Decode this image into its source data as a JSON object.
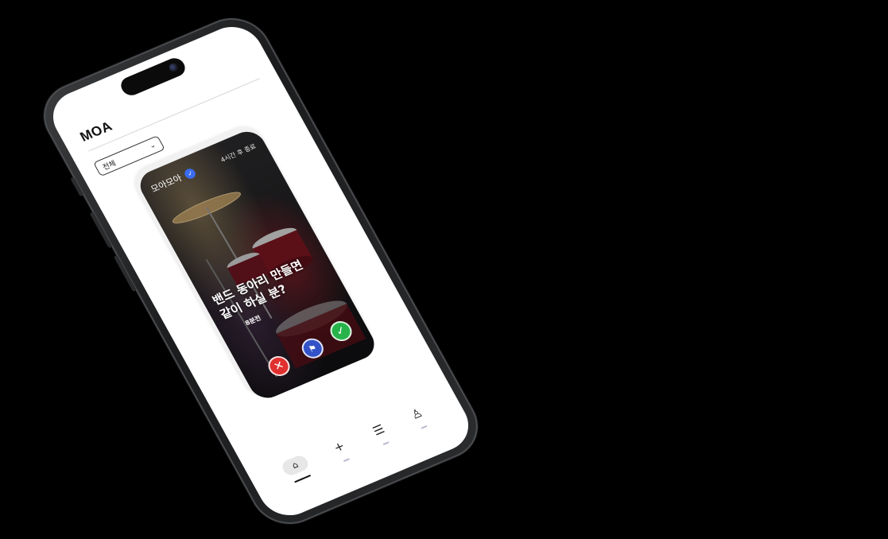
{
  "app": {
    "logo": "MOA"
  },
  "filter": {
    "selected": "전체"
  },
  "card": {
    "author": "모아모아",
    "deadline": "4시간 후 종료",
    "title_line1": "밴드 동아리 만들면",
    "title_line2": "같이 하실 분?",
    "meta": "8분전"
  },
  "actions": {
    "reject_icon": "close-icon",
    "flag_icon": "flag-icon",
    "accept_icon": "check-icon"
  },
  "nav": {
    "items": [
      {
        "icon": "home-icon",
        "active": true
      },
      {
        "icon": "plus-icon",
        "active": false
      },
      {
        "icon": "list-check-icon",
        "active": false
      },
      {
        "icon": "user-icon",
        "active": false
      }
    ]
  },
  "colors": {
    "reject": "#e0302f",
    "flag": "#3352c8",
    "accept": "#27b34a",
    "verified": "#3b6cf0",
    "nav_indicator": "#b9bad3"
  }
}
